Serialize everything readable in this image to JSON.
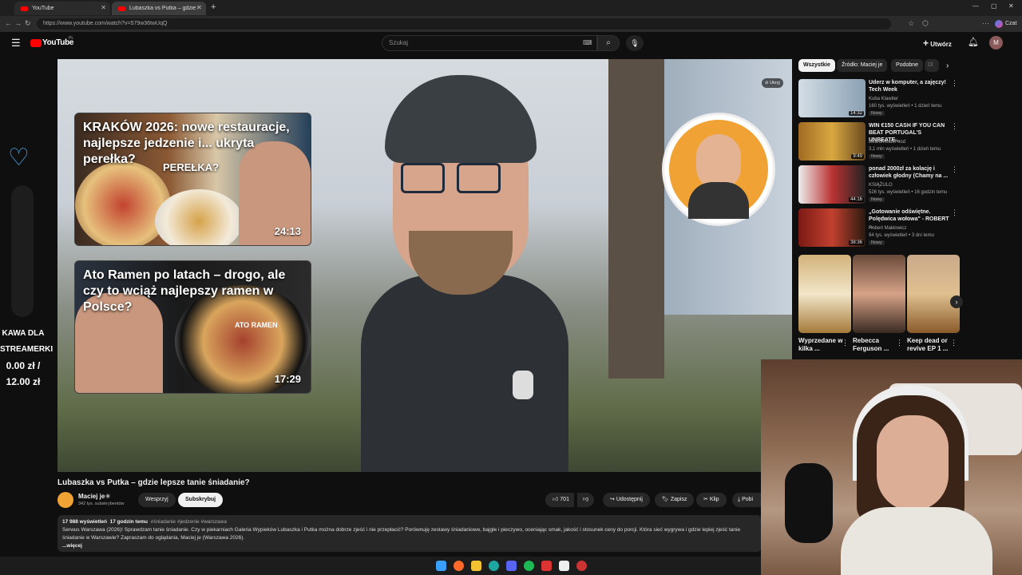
{
  "browser": {
    "tabs": [
      {
        "label": "YouTube"
      },
      {
        "label": "Lubaszka vs Putka – gdzie lepsze t..."
      }
    ],
    "url": "https://www.youtube.com/watch?v=579w36twUqQ",
    "profile_label": "Czat"
  },
  "youtube": {
    "logo": "YouTube",
    "region": "PL",
    "search_placeholder": "Szukaj",
    "create_label": "Utwórz",
    "avatar_letter": "M"
  },
  "video": {
    "hide_label": "Ukryj",
    "cards": [
      {
        "title": "KRAKÓW 2026: nowe restauracje, najlepsze jedzenie i... ukryta perełka?",
        "tag": "PEREŁKA?",
        "duration": "24:13"
      },
      {
        "title": "Ato Ramen po latach – drogo, ale czy to wciąż najlepszy ramen w Polsce?",
        "tag": "ATO RAMEN",
        "duration": "17:29"
      }
    ],
    "title": "Lubaszka vs Putka – gdzie lepsze tanie śniadanie?",
    "channel": "Maciej je",
    "subscribers": "342 tys. subskrybentów",
    "support_label": "Wesprzyj",
    "subscribe_label": "Subskrybuj",
    "likes": "701",
    "share_label": "Udostępnij",
    "save_label": "Zapisz",
    "clip_label": "Klip",
    "download_label": "Pobi",
    "views": "17 988 wyświetleń",
    "age": "17 godzin temu",
    "hashtags": "#śniadanie #jedzenie #warszawa",
    "description": "Serwus Warszawa (2026)! Sprawdzam tanie śniadanie. Czy w piekarniach Galeria Wypieków Lubaszka i Putka można dobrze zjeść i nie przepłacić? Porównuję zestawy śniadaniowe, bajgle i pieczywo, oceniając smak, jakość i stosunek ceny do porcji. Która sieć wygrywa i gdzie lepiej zjeść tanie śniadanie w Warszawie? Zapraszam do oglądania, Maciej je (Warszawa 2026).",
    "more_label": "...więcej"
  },
  "overlay": {
    "line1": "KAWA DLA",
    "line2": "STREAMERKI",
    "line3": "0.00 zł /",
    "line4": "12.00 zł"
  },
  "sidebar": {
    "chips": [
      "Wszystkie",
      "Źródło: Maciej je",
      "Podobne",
      "Dl"
    ],
    "recs": [
      {
        "title": "Uderz w komputer, a zajęczy! Tech Week",
        "channel": "Kuba Klawiter",
        "meta": "160 tys. wyświetleń • 1 dzień temu",
        "badge": "Nowy",
        "duration": "14:32",
        "color": "#c9d6e0"
      },
      {
        "title": "WIN €150 CASH IF YOU CAN BEAT PORTUGAL'S UNBEATE...",
        "channel": "BeardMeatsFood",
        "meta": "3,1 mln wyświetleń • 1 dzień temu",
        "badge": "Nowy",
        "duration": "9:49",
        "color": "#c89a3a"
      },
      {
        "title": "ponad 2000zł za kolację i człowiek głodny (Chamy na ...",
        "channel": "KSIĄŻULO",
        "meta": "526 tys. wyświetleń • 16 godzin temu",
        "badge": "Nowy",
        "duration": "44:16",
        "color": "#e8e8e8"
      },
      {
        "title": "„Gotowanie odświętne. Polędwica wołowa\" - ROBERT ...",
        "channel": "Robert Makłowicz",
        "meta": "94 tys. wyświetleń • 3 dni temu",
        "badge": "Nowy",
        "duration": "38:36",
        "color": "#b8332b"
      }
    ],
    "shorts": [
      {
        "title": "Wyprzedane w kilka ..."
      },
      {
        "title": "Rebecca Ferguson ..."
      },
      {
        "title": "Keep dead or revive EP 1 ..."
      }
    ]
  }
}
